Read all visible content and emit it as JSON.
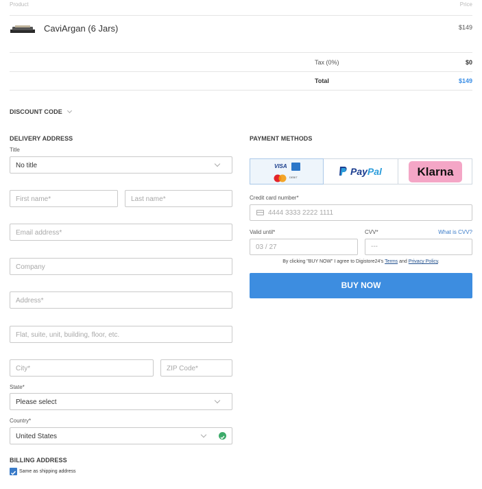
{
  "cart": {
    "product_header": "Product",
    "price_header": "Price",
    "product_name": "CaviArgan (6 Jars)",
    "product_price": "$149",
    "tax_label": "Tax (0%)",
    "tax_value": "$0",
    "total_label": "Total",
    "total_value": "$149"
  },
  "discount": {
    "label": "DISCOUNT CODE"
  },
  "delivery": {
    "heading": "DELIVERY ADDRESS",
    "title_label": "Title",
    "title_value": "No title",
    "first_name_ph": "First name*",
    "last_name_ph": "Last name*",
    "email_ph": "Email address*",
    "company_ph": "Company",
    "address_ph": "Address*",
    "address2_ph": "Flat, suite, unit, building, floor, etc.",
    "city_ph": "City*",
    "zip_ph": "ZIP Code*",
    "state_label": "State*",
    "state_value": "Please select",
    "country_label": "Country*",
    "country_value": "United States"
  },
  "billing": {
    "heading": "BILLING ADDRESS",
    "same_as_shipping": "Same as shipping address",
    "same_checked": true
  },
  "payment": {
    "heading": "PAYMENT METHODS",
    "methods": {
      "visa": "VISA",
      "paypal_pay": "Pay",
      "paypal_pal": "Pal",
      "klarna": "Klarna",
      "mc": "DEBIT"
    },
    "card_label": "Credit card number*",
    "card_ph": "4444 3333 2222 1111",
    "valid_label": "Valid until*",
    "valid_ph": "03 / 27",
    "cvv_label": "CVV*",
    "cvv_ph": "---",
    "cvv_help": "What is CVV?",
    "terms_prefix": "By clicking \"BUY NOW\" I agree to Digistore24's",
    "terms_link": "Terms",
    "terms_and": "and",
    "privacy_link": "Privacy Policy",
    "terms_suffix": ".",
    "buy_button": "BUY NOW"
  },
  "colors": {
    "accent": "#3d8de0",
    "klarna_pink": "#f4a6c6",
    "checkbox": "#3a7bc8",
    "valid_green": "#3dab6a"
  }
}
